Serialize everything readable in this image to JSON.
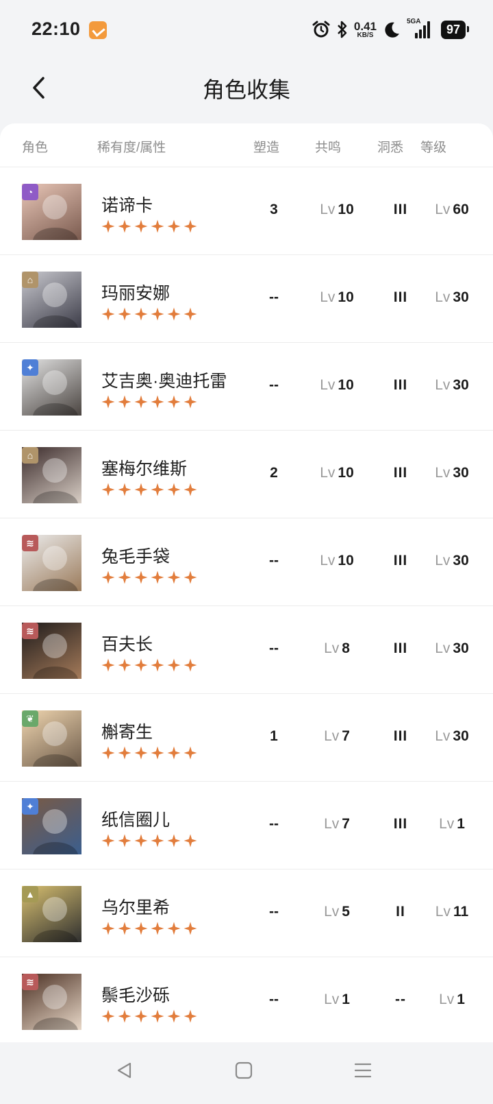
{
  "status_bar": {
    "time": "22:10",
    "net_speed": "0.41",
    "net_unit": "KB/S",
    "signal_label": "5GA",
    "battery": "97",
    "icons": [
      "app-badge-icon",
      "alarm-icon",
      "bluetooth-icon",
      "moon-icon",
      "signal-icon"
    ]
  },
  "header": {
    "title": "角色收集",
    "back_icon": "chevron-left-icon"
  },
  "columns": {
    "character": "角色",
    "rarity": "稀有度/属性",
    "shaping": "塑造",
    "resonance": "共鸣",
    "insight": "洞悉",
    "level": "等级"
  },
  "lv_prefix": "Lv",
  "colors": {
    "star": "#e27d3c",
    "element_purple": "#8f5bc6",
    "element_tan": "#b0946a",
    "element_blue": "#4f7fd6",
    "element_red": "#b85a5a",
    "element_green": "#6aa86a",
    "element_olive": "#a59a55"
  },
  "characters": [
    {
      "name": "诺谛卡",
      "stars": 6,
      "element": "purple",
      "shaping": "3",
      "resonance": "10",
      "insight": "III",
      "level": "60"
    },
    {
      "name": "玛丽安娜",
      "stars": 6,
      "element": "tan",
      "shaping": "--",
      "resonance": "10",
      "insight": "III",
      "level": "30"
    },
    {
      "name": "艾吉奥·奥迪托雷",
      "stars": 6,
      "element": "blue",
      "shaping": "--",
      "resonance": "10",
      "insight": "III",
      "level": "30"
    },
    {
      "name": "塞梅尔维斯",
      "stars": 6,
      "element": "tan",
      "shaping": "2",
      "resonance": "10",
      "insight": "III",
      "level": "30"
    },
    {
      "name": "兔毛手袋",
      "stars": 6,
      "element": "red",
      "shaping": "--",
      "resonance": "10",
      "insight": "III",
      "level": "30"
    },
    {
      "name": "百夫长",
      "stars": 6,
      "element": "red",
      "shaping": "--",
      "resonance": "8",
      "insight": "III",
      "level": "30"
    },
    {
      "name": "槲寄生",
      "stars": 6,
      "element": "green",
      "shaping": "1",
      "resonance": "7",
      "insight": "III",
      "level": "30"
    },
    {
      "name": "纸信圈儿",
      "stars": 6,
      "element": "blue",
      "shaping": "--",
      "resonance": "7",
      "insight": "III",
      "level": "1"
    },
    {
      "name": "乌尔里希",
      "stars": 6,
      "element": "olive",
      "shaping": "--",
      "resonance": "5",
      "insight": "II",
      "level": "11"
    },
    {
      "name": "鬃毛沙砾",
      "stars": 6,
      "element": "red",
      "shaping": "--",
      "resonance": "1",
      "insight": "--",
      "level": "1"
    }
  ],
  "nav_bar": {
    "icons": [
      "back-triangle-icon",
      "home-square-icon",
      "menu-lines-icon"
    ]
  }
}
